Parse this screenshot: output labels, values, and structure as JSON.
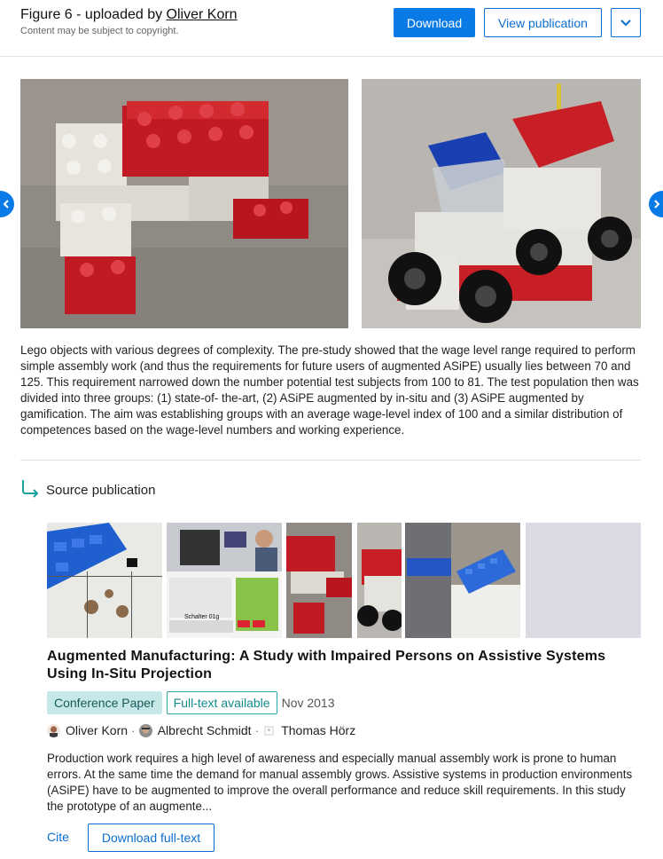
{
  "header": {
    "figure_prefix": "Figure 6 - uploaded by ",
    "uploader": "Oliver Korn",
    "copyright_note": "Content may be subject to copyright.",
    "download_label": "Download",
    "view_publication_label": "View publication",
    "more_icon": "chevron-down-icon"
  },
  "figure": {
    "caption": "Lego objects with various degrees of complexity. The pre-study showed that the wage level range required to perform simple assembly work (and thus the requirements for future users of augmented ASiPE) usually lies between 70 and 125. This requirement narrowed down the number potential test subjects from 100 to 81. The test population then was divided into three groups: (1) state-of- the-art, (2) ASiPE augmented by in-situ and (3) ASiPE augmented by gamification. The aim was establishing groups with an average wage-level index of 100 and a similar distribution of competences based on the wage-level numbers and working experience."
  },
  "source": {
    "heading": "Source publication",
    "title": "Augmented Manufacturing: A Study with Impaired Persons on Assistive Systems Using In-Situ Projection",
    "type_badge": "Conference Paper",
    "fulltext_badge": "Full-text available",
    "date": "Nov 2013",
    "authors": [
      "Oliver Korn",
      "Albrecht Schmidt",
      "Thomas Hörz"
    ],
    "author_separator": "·",
    "thumb_label": "Schalter 01g",
    "abstract": "Production work requires a high level of awareness and especially manual assembly work is prone to human errors. At the same time the demand for manual assembly grows. Assistive systems in production environments (ASiPE) have to be augmented to improve the overall performance and reduce skill requirements. In this study the prototype of an augmente...",
    "cite_label": "Cite",
    "download_fulltext_label": "Download full-text"
  },
  "colors": {
    "accent": "#0a7ae6",
    "teal_badge_bg": "#c6e8e8",
    "teal_border": "#2aa5a5"
  }
}
